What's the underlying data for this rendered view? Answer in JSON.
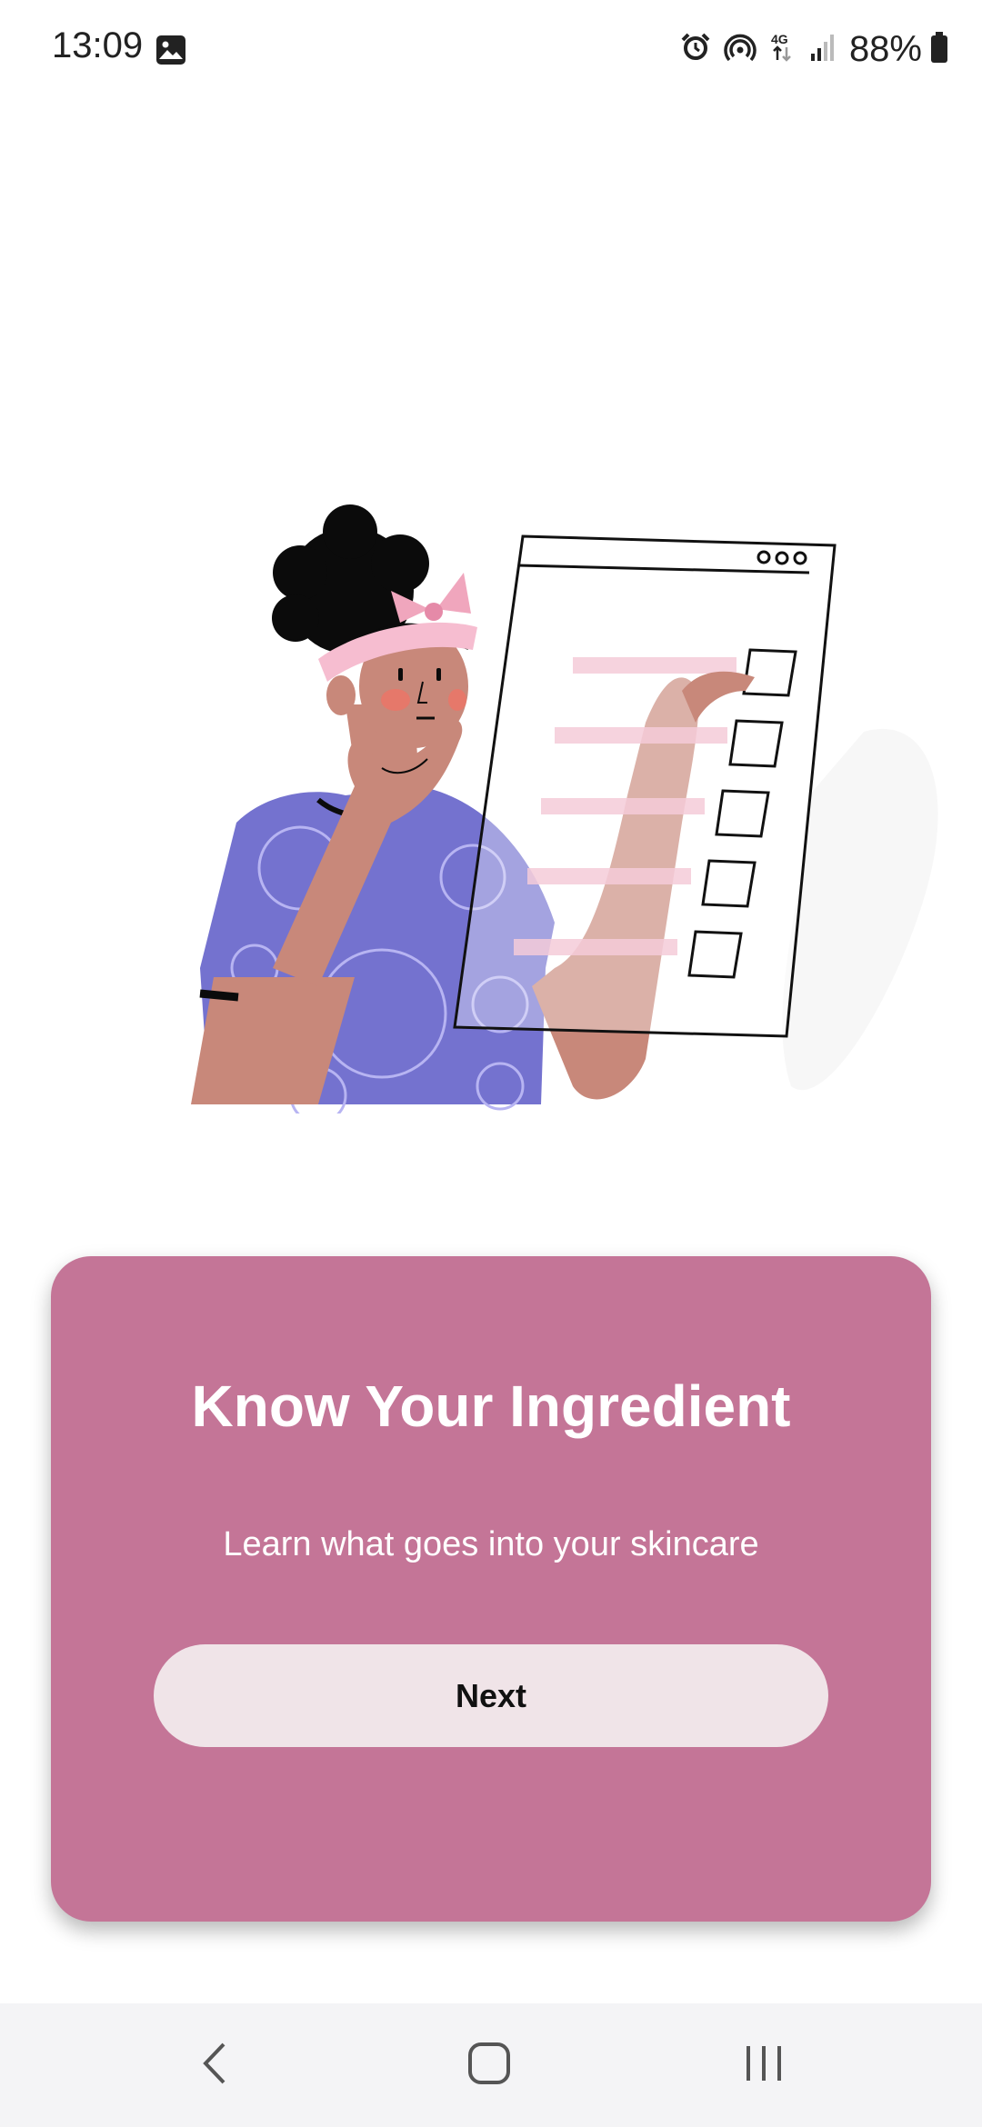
{
  "status_bar": {
    "time": "13:09",
    "battery": "88%",
    "icons": [
      "gallery-icon",
      "alarm-icon",
      "hotspot-icon",
      "network-4g-icon",
      "signal-icon",
      "battery-icon"
    ]
  },
  "onboarding": {
    "title": "Know Your Ingredient",
    "subtitle": "Learn what goes into your skincare",
    "next_label": "Next"
  },
  "colors": {
    "card": "#c47597",
    "button": "#f0e4e8",
    "shirt": "#7472cf",
    "skin": "#c8887a",
    "accent_pink": "#f0a6bd"
  },
  "nav_bar": {
    "icons": [
      "back-icon",
      "home-icon",
      "recents-icon"
    ]
  }
}
